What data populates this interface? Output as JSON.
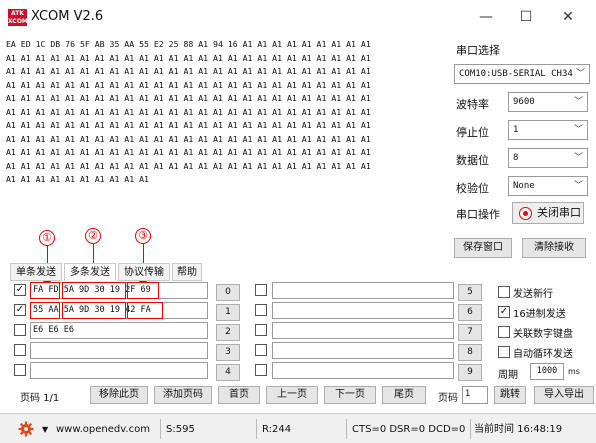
{
  "window": {
    "logo_text": "ATK XCOM",
    "title": "XCOM V2.6",
    "minimize_glyph": "—",
    "maximize_glyph": "☐",
    "close_glyph": "✕"
  },
  "receive": {
    "lines": [
      "EA ED 1C DB 76 5F AB 35 AA 55 E2 25 88 A1 94 16 A1 A1 A1 A1 A1 A1 A1 A1 A1",
      "A1 A1 A1 A1 A1 A1 A1 A1 A1 A1 A1 A1 A1 A1 A1 A1 A1 A1 A1 A1 A1 A1 A1 A1 A1",
      "A1 A1 A1 A1 A1 A1 A1 A1 A1 A1 A1 A1 A1 A1 A1 A1 A1 A1 A1 A1 A1 A1 A1 A1 A1",
      "A1 A1 A1 A1 A1 A1 A1 A1 A1 A1 A1 A1 A1 A1 A1 A1 A1 A1 A1 A1 A1 A1 A1 A1 A1",
      "A1 A1 A1 A1 A1 A1 A1 A1 A1 A1 A1 A1 A1 A1 A1 A1 A1 A1 A1 A1 A1 A1 A1 A1 A1",
      "A1 A1 A1 A1 A1 A1 A1 A1 A1 A1 A1 A1 A1 A1 A1 A1 A1 A1 A1 A1 A1 A1 A1 A1 A1",
      "A1 A1 A1 A1 A1 A1 A1 A1 A1 A1 A1 A1 A1 A1 A1 A1 A1 A1 A1 A1 A1 A1 A1 A1 A1",
      "A1 A1 A1 A1 A1 A1 A1 A1 A1 A1 A1 A1 A1 A1 A1 A1 A1 A1 A1 A1 A1 A1 A1 A1 A1",
      "A1 A1 A1 A1 A1 A1 A1 A1 A1 A1 A1 A1 A1 A1 A1 A1 A1 A1 A1 A1 A1 A1 A1 A1 A1",
      "A1 A1 A1 A1 A1 A1 A1 A1 A1 A1 A1 A1 A1 A1 A1 A1 A1 A1 A1 A1 A1 A1 A1 A1 A1",
      "A1 A1 A1 A1 A1 A1 A1 A1 A1 A1"
    ]
  },
  "settings": {
    "port_label": "串口选择",
    "port_value": "COM10:USB-SERIAL CH34",
    "baud_label": "波特率",
    "baud_value": "9600",
    "stop_label": "停止位",
    "stop_value": "1",
    "data_label": "数据位",
    "data_value": "8",
    "parity_label": "校验位",
    "parity_value": "None",
    "op_label": "串口操作",
    "close_port": "关闭串口",
    "save_window": "保存窗口",
    "clear_receive": "清除接收"
  },
  "tabs": [
    "单条发送",
    "多条发送",
    "协议传输",
    "帮助"
  ],
  "annotations": [
    "①",
    "②",
    "③"
  ],
  "multi_rows": [
    {
      "checked": true,
      "text": "FA FD 5A 9D 30 19 2F 69",
      "num": "0"
    },
    {
      "checked": true,
      "text": "55 AA 5A 9D 30 19 42 FA",
      "num": "1"
    },
    {
      "checked": false,
      "text": "E6 E6 E6",
      "num": "2"
    },
    {
      "checked": false,
      "text": "",
      "num": "3"
    },
    {
      "checked": false,
      "text": "",
      "num": "4"
    }
  ],
  "multi_rows_right": [
    {
      "checked": false,
      "text": "",
      "num": "5"
    },
    {
      "checked": false,
      "text": "",
      "num": "6"
    },
    {
      "checked": false,
      "text": "",
      "num": "7"
    },
    {
      "checked": false,
      "text": "",
      "num": "8"
    },
    {
      "checked": false,
      "text": "",
      "num": "9"
    }
  ],
  "options": {
    "send_newline": "发送新行",
    "hex_send": "16进制发送",
    "link_keyboard": "关联数字键盘",
    "auto_loop": "自动循环发送",
    "period_label": "周期",
    "period_value": "1000",
    "period_unit": "ms"
  },
  "paging": {
    "page_label": "页码 1/1",
    "remove_page": "移除此页",
    "add_page": "添加页码",
    "first_page": "首页",
    "prev_page": "上一页",
    "next_page": "下一页",
    "last_page": "尾页",
    "goto_label": "页码",
    "goto_value": "1",
    "jump": "跳转",
    "import": "导入导出"
  },
  "status": {
    "url": "www.openedv.com",
    "sent": "S:595",
    "received": "R:244",
    "lines": "CTS=0 DSR=0 DCD=0",
    "time": "当前时间 16:48:19"
  },
  "colors": {
    "accent_red": "#e00000",
    "status_bg": "#f0f0f0"
  }
}
